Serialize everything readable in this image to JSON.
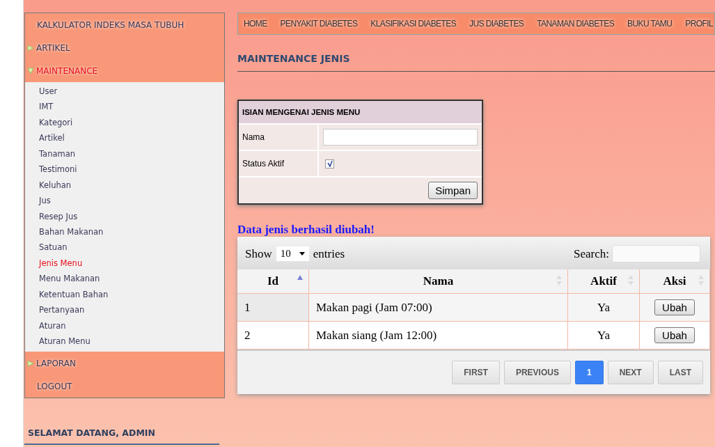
{
  "sidebar": {
    "items": [
      {
        "kind": "link",
        "label": "KALKULATOR INDEKS MASA TUBUH"
      },
      {
        "kind": "group",
        "label": "ARTIKEL",
        "expanded": false
      },
      {
        "kind": "group",
        "label": "MAINTENANCE",
        "expanded": true,
        "children": [
          {
            "label": "User",
            "selected": false
          },
          {
            "label": "IMT",
            "selected": false
          },
          {
            "label": "Kategori",
            "selected": false
          },
          {
            "label": "Artikel",
            "selected": false
          },
          {
            "label": "Tanaman",
            "selected": false
          },
          {
            "label": "Testimoni",
            "selected": false
          },
          {
            "label": "Keluhan",
            "selected": false
          },
          {
            "label": "Jus",
            "selected": false
          },
          {
            "label": "Resep Jus",
            "selected": false
          },
          {
            "label": "Bahan Makanan",
            "selected": false
          },
          {
            "label": "Satuan",
            "selected": false
          },
          {
            "label": "Jenis Menu",
            "selected": true
          },
          {
            "label": "Menu Makanan",
            "selected": false
          },
          {
            "label": "Ketentuan Bahan",
            "selected": false
          },
          {
            "label": "Pertanyaan",
            "selected": false
          },
          {
            "label": "Aturan",
            "selected": false
          },
          {
            "label": "Aturan Menu",
            "selected": false
          }
        ]
      },
      {
        "kind": "group",
        "label": "LAPORAN",
        "expanded": false
      },
      {
        "kind": "link",
        "label": "LOGOUT"
      }
    ],
    "welcome": "SELAMAT DATANG, ADMIN"
  },
  "nav": [
    "HOME",
    "PENYAKIT DIABETES",
    "KLASIFIKASI DIABETES",
    "JUS DIABETES",
    "TANAMAN DIABETES",
    "BUKU TAMU",
    "PROFIL"
  ],
  "page_title": "MAINTENANCE JENIS",
  "form": {
    "title": "ISIAN MENGENAI JENIS MENU",
    "name_label": "Nama",
    "status_label": "Status Aktif",
    "status_checked": true,
    "submit": "Simpan"
  },
  "message": "Data jenis berhasil diubah!",
  "table": {
    "show_label": "Show",
    "page_size": "10",
    "entries_label": "entries",
    "search_label": "Search:",
    "columns": [
      {
        "label": "Id",
        "sorted": true
      },
      {
        "label": "Nama",
        "sorted": false
      },
      {
        "label": "Aktif",
        "sorted": false
      },
      {
        "label": "Aksi",
        "sorted": false
      }
    ],
    "rows": [
      {
        "id": "1",
        "nama": "Makan pagi (Jam 07:00)",
        "aktif": "Ya",
        "action": "Ubah"
      },
      {
        "id": "2",
        "nama": "Makan siang (Jam 12:00)",
        "aktif": "Ya",
        "action": "Ubah"
      }
    ],
    "pagination": [
      {
        "label": "FIRST",
        "selected": false
      },
      {
        "label": "PREVIOUS",
        "selected": false
      },
      {
        "label": "1",
        "selected": true
      },
      {
        "label": "NEXT",
        "selected": false
      },
      {
        "label": "LAST",
        "selected": false
      }
    ]
  }
}
